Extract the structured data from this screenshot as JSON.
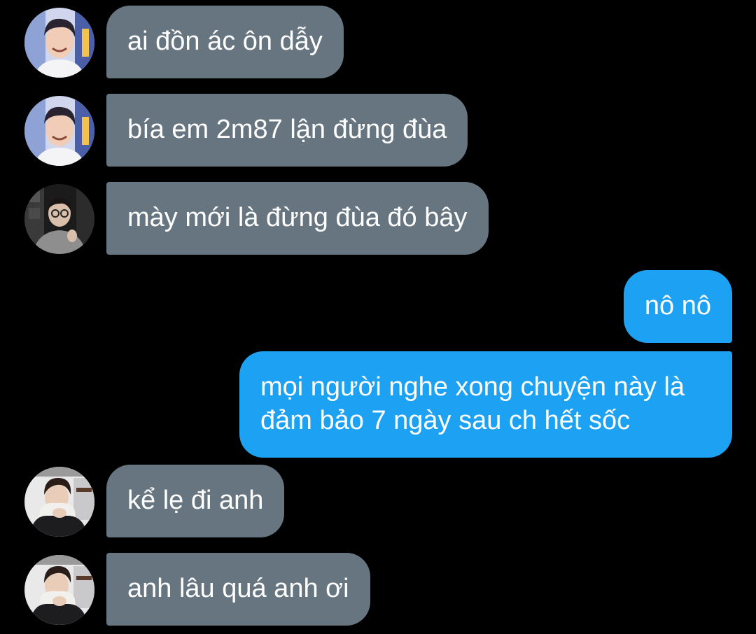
{
  "conversation": {
    "messages": [
      {
        "text": "ai đồn ác ôn dẫy",
        "direction": "incoming",
        "avatar": "avatar-smiling-man-light"
      },
      {
        "text": "bía em 2m87 lận đừng đùa",
        "direction": "incoming",
        "avatar": "avatar-smiling-man-light"
      },
      {
        "text": "mày mới là đừng đùa đó bây",
        "direction": "incoming",
        "avatar": "avatar-man-glasses-dark"
      },
      {
        "text": "nô nô",
        "direction": "outgoing"
      },
      {
        "lines": [
          "mọi người nghe xong chuyện này là",
          "đảm bảo 7 ngày sau ch hết sốc"
        ],
        "direction": "outgoing"
      },
      {
        "text": "kể lẹ đi anh",
        "direction": "incoming",
        "avatar": "avatar-man-hoodie"
      },
      {
        "text": "anh lâu quá anh ơi",
        "direction": "incoming",
        "avatar": "avatar-man-hoodie"
      }
    ]
  },
  "colors": {
    "background": "#000000",
    "incoming_bubble": "#66757f",
    "outgoing_bubble": "#1da1f2",
    "text": "#ffffff"
  }
}
